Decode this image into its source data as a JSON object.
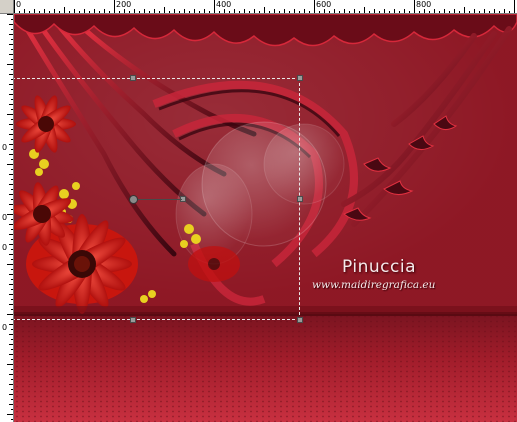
{
  "rulers": {
    "top_labels": [
      "0",
      "200",
      "400",
      "600",
      "800"
    ],
    "left_labels": [
      "0",
      "0",
      "0",
      "0"
    ]
  },
  "canvas": {
    "watermark_name": "Pinuccia",
    "watermark_url": "www.maidiregrafica.eu"
  },
  "colors": {
    "background": "#8a1420",
    "floor": "#a8202e",
    "flower_red": "#d41a1a",
    "flower_yellow": "#e8d020"
  },
  "tool": {
    "type": "pick-tool-selection",
    "handles": [
      "top-left",
      "top-center",
      "top-right",
      "middle-right",
      "bottom-left",
      "bottom-center",
      "bottom-right",
      "rotation-pivot"
    ]
  }
}
